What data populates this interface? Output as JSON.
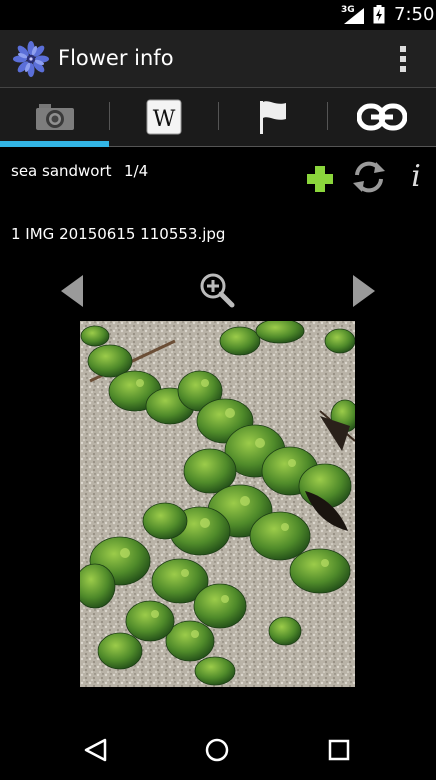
{
  "status_bar": {
    "network": "3G",
    "time": "7:50"
  },
  "action_bar": {
    "title": "Flower info",
    "logo_icon": "cornflower-logo-icon",
    "overflow_icon": "overflow-menu-icon"
  },
  "tabs": [
    {
      "icon": "camera-icon",
      "selected": true
    },
    {
      "icon": "wikipedia-icon",
      "selected": false
    },
    {
      "icon": "flag-icon",
      "selected": false
    },
    {
      "icon": "link-icon",
      "selected": false
    }
  ],
  "flower": {
    "name": "sea sandwort",
    "count": "1/4"
  },
  "image": {
    "filename": "1 IMG 20150615 110553.jpg"
  },
  "actions": {
    "add_icon": "plus-icon",
    "refresh_icon": "refresh-icon",
    "info_label": "i"
  },
  "colors": {
    "accent": "#33b5e5",
    "add_green": "#8bd63c",
    "action_bar": "#212121"
  }
}
